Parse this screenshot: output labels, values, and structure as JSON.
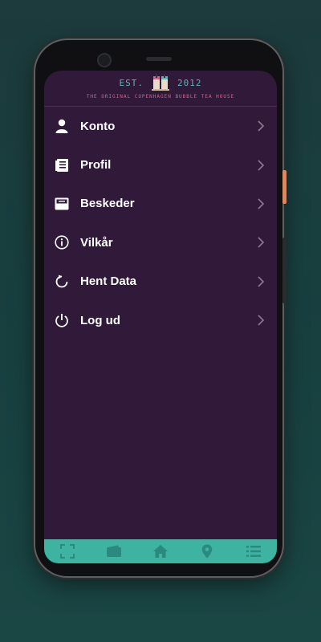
{
  "header": {
    "est_label": "EST.",
    "year": "2012",
    "tagline": "THE ORIGINAL COPENHAGEN BUBBLE TEA HOUSE"
  },
  "menu": {
    "items": [
      {
        "label": "Konto",
        "icon": "user-icon"
      },
      {
        "label": "Profil",
        "icon": "profile-card-icon"
      },
      {
        "label": "Beskeder",
        "icon": "inbox-icon"
      },
      {
        "label": "Vilkår",
        "icon": "info-icon"
      },
      {
        "label": "Hent Data",
        "icon": "refresh-icon"
      },
      {
        "label": "Log ud",
        "icon": "power-icon"
      }
    ]
  },
  "bottom_nav": {
    "items": [
      "scan-icon",
      "wallet-icon",
      "home-icon",
      "location-pin-icon",
      "menu-list-icon"
    ]
  },
  "colors": {
    "screen_bg": "#311a39",
    "accent_teal": "#3db3a0",
    "nav_icon": "#2a8a7b",
    "logo_teal": "#5fb3b8",
    "tagline_pink": "#d4608f"
  }
}
